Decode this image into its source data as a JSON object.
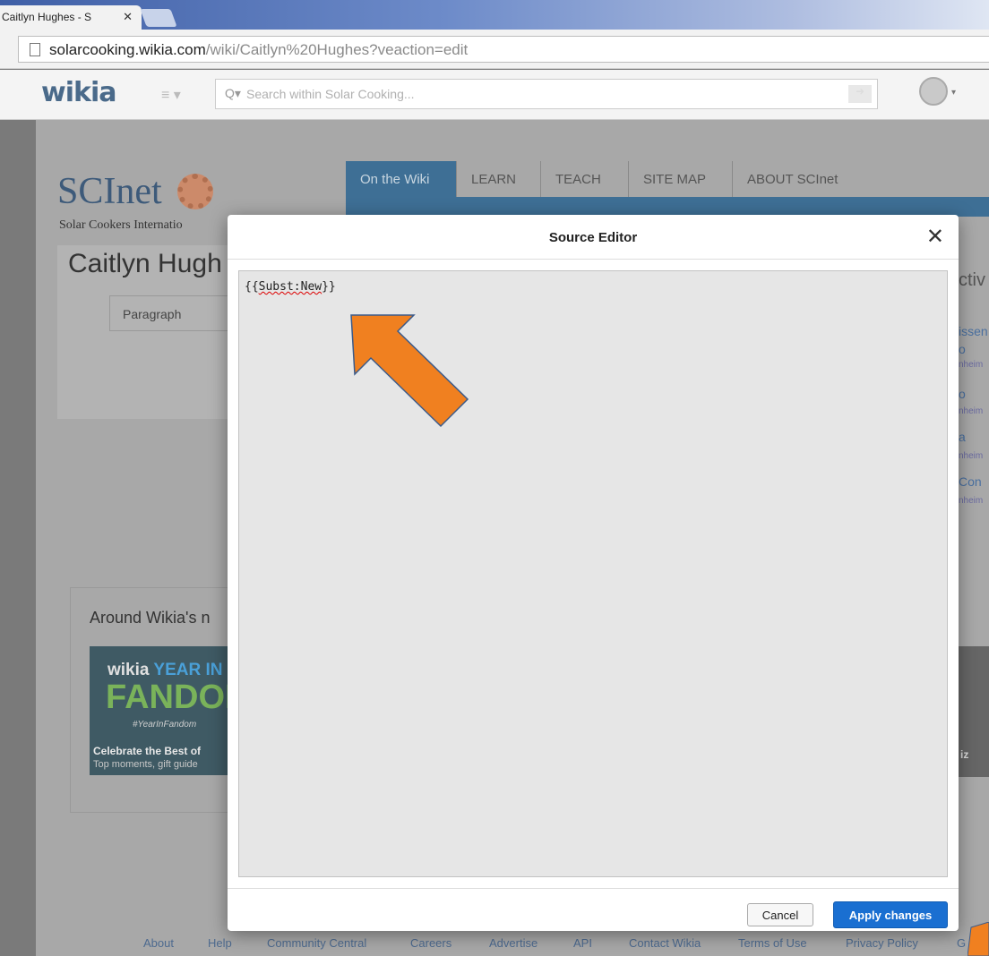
{
  "browser": {
    "tab_title": "Caitlyn Hughes - S",
    "tab_close": "✕",
    "url_host": "solarcooking.wikia.com",
    "url_path": "/wiki/Caitlyn%20Hughes?veaction=edit"
  },
  "wikia_nav": {
    "logo": "wikia",
    "menu_caret": "≡ ▾",
    "search_placeholder": "Search within Solar Cooking...",
    "search_icon": "Q▾",
    "avatar_caret": "▾"
  },
  "site": {
    "logo": "SCInet",
    "subtitle": "Solar Cookers Internatio",
    "tabs": [
      "On the Wiki",
      "LEARN",
      "TEACH",
      "SITE MAP",
      "ABOUT SCInet"
    ],
    "page_title": "Caitlyn Hugh",
    "format_select": "Paragraph",
    "around_title": "Around Wikia's n",
    "promo_brand": "wikia",
    "promo_year": "YEAR IN",
    "promo_fandom": "FANDOM",
    "promo_tag": "#YearInFandom",
    "promo_caption": "Celebrate the Best of",
    "promo_subcaption": "Top moments, gift guide",
    "right_heading": "ctiv",
    "right_links": [
      "issen",
      "o",
      "nheim",
      "o",
      "nheim",
      "a",
      "nheim",
      "Con",
      "nheim"
    ],
    "right_img_text": "iz"
  },
  "footer": [
    "About",
    "Help",
    "Community Central",
    "Careers",
    "Advertise",
    "API",
    "Contact Wikia",
    "Terms of Use",
    "Privacy Policy",
    "G"
  ],
  "modal": {
    "title": "Source Editor",
    "close": "✕",
    "content_prefix": "{{",
    "content_word": "Subst:New",
    "content_suffix": "}}",
    "cancel_label": "Cancel",
    "apply_label": "Apply changes"
  },
  "colors": {
    "accent": "#1a6fd1",
    "arrow": "#f08020",
    "overlay": "#7a7a7a"
  }
}
